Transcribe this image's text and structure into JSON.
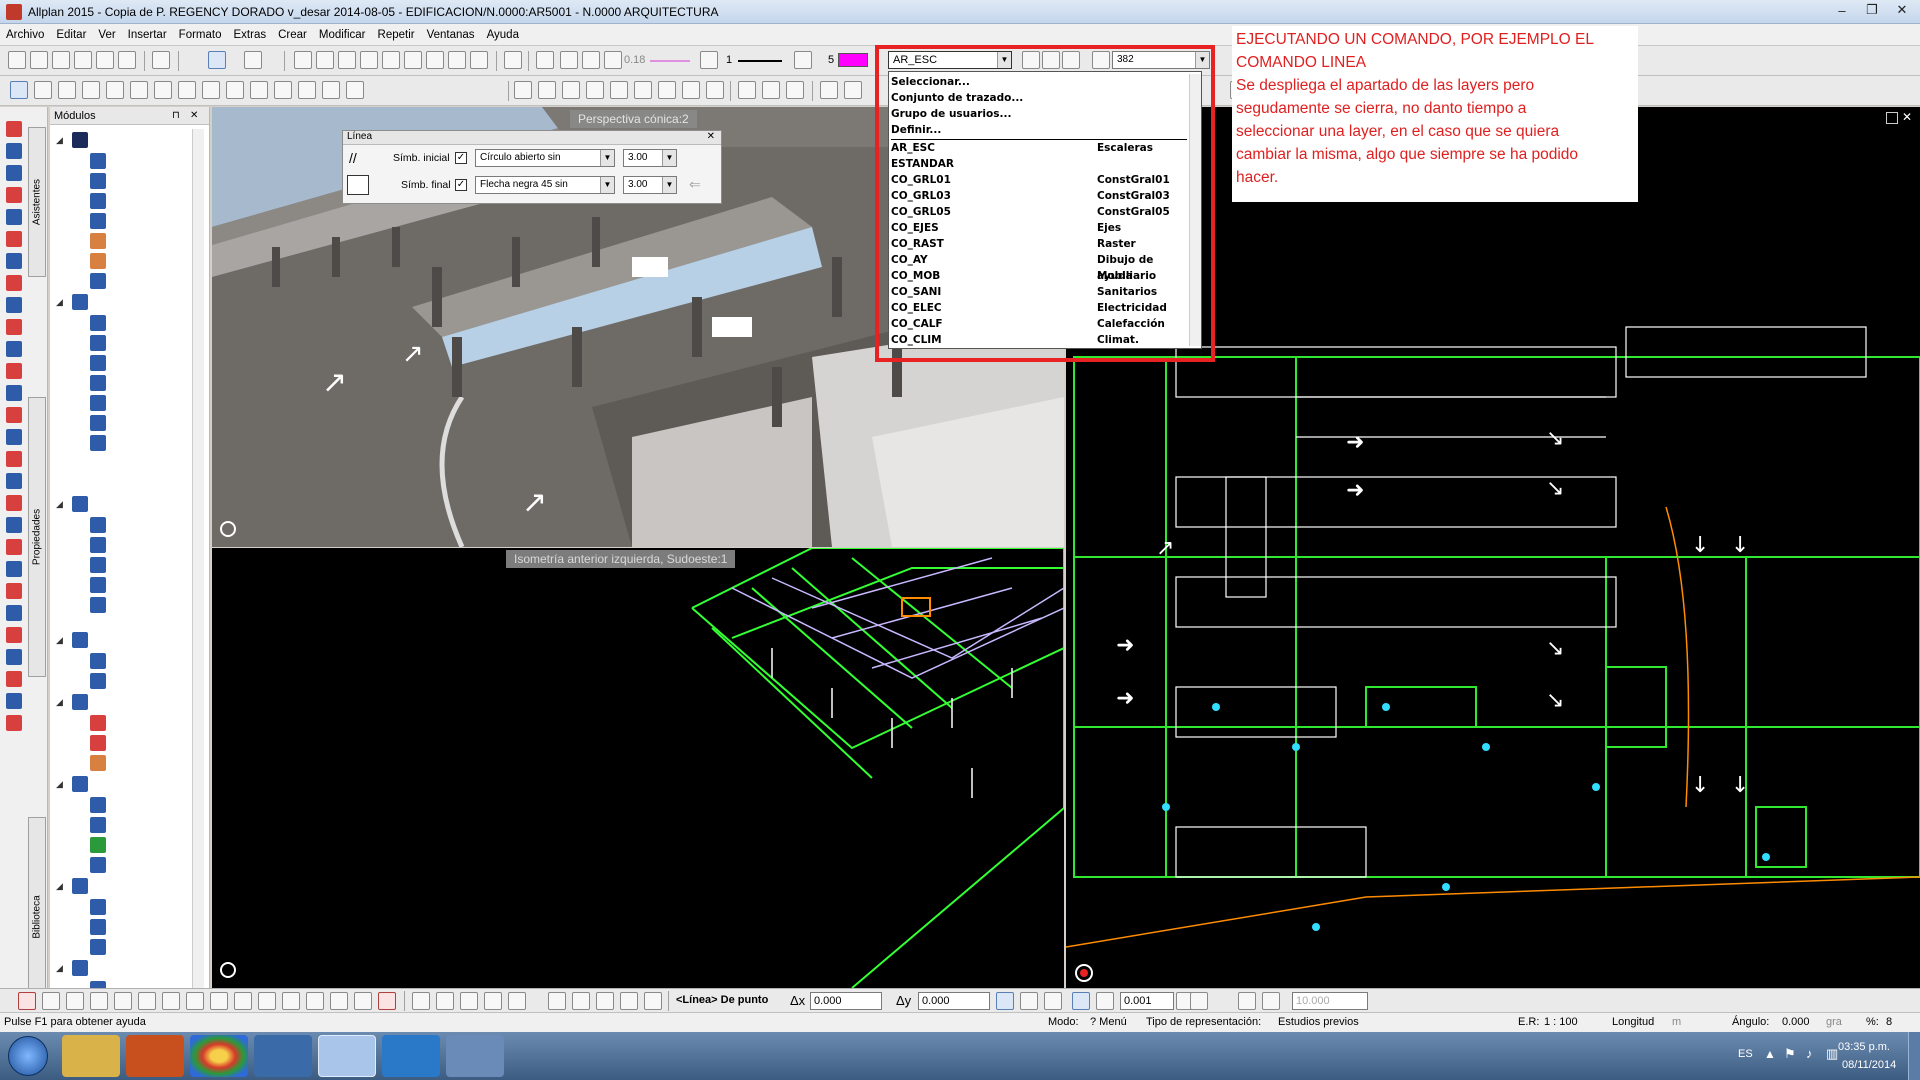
{
  "window": {
    "title": "Allplan 2015 - Copia de  P. REGENCY DORADO v_desar 2014-08-05 - EDIFICACION/N.0000:AR5001 - N.0000 ARQUITECTURA",
    "minimize": "–",
    "maximize": "❐",
    "close": "✕"
  },
  "menu": [
    "Archivo",
    "Editar",
    "Ver",
    "Insertar",
    "Formato",
    "Extras",
    "Crear",
    "Modificar",
    "Repetir",
    "Ventanas",
    "Ayuda"
  ],
  "toolbar": {
    "pen_value": "0.18",
    "line_value": "1",
    "color_value": "5",
    "layer_value": "AR_ESC",
    "scale_value": "382"
  },
  "modules": {
    "header": "Módulos",
    "pin": "⊓",
    "close": "✕"
  },
  "side_tabs": [
    "Asistentes",
    "Propiedades",
    "Biblioteca"
  ],
  "viewports": {
    "perspective_label": "Perspectiva cónica:2",
    "isometric_label": "Isometría anterior izquierda, Sudoeste:1"
  },
  "linea_panel": {
    "title": "Línea",
    "row1_label": "Símb. inicial",
    "row1_symbol": "Círculo abierto sin",
    "row1_size": "3.00",
    "row2_label": "Símb. final",
    "row2_symbol": "Flecha negra 45 sin",
    "row2_size": "3.00"
  },
  "layer_dropdown": {
    "actions": [
      "Seleccionar...",
      "Conjunto de trazado...",
      "Grupo de usuarios...",
      "Definir..."
    ],
    "layers": [
      {
        "name": "AR_ESC",
        "desc": "Escaleras"
      },
      {
        "name": "ESTANDAR",
        "desc": ""
      },
      {
        "name": "CO_GRL01",
        "desc": "ConstGral01"
      },
      {
        "name": "CO_GRL03",
        "desc": "ConstGral03"
      },
      {
        "name": "CO_GRL05",
        "desc": "ConstGral05"
      },
      {
        "name": "CO_EJES",
        "desc": "Ejes"
      },
      {
        "name": "CO_RAST",
        "desc": "Raster"
      },
      {
        "name": "CO_AY",
        "desc": "Dibujo de ayuda"
      },
      {
        "name": "CO_MOB",
        "desc": "Mobiliario"
      },
      {
        "name": "CO_SANI",
        "desc": "Sanitarios"
      },
      {
        "name": "CO_ELEC",
        "desc": "Electricidad"
      },
      {
        "name": "CO_CALF",
        "desc": "Calefacción"
      },
      {
        "name": "CO_CLIM",
        "desc": "Climat."
      }
    ]
  },
  "annotation": {
    "line1": "EJECUTANDO UN COMANDO, POR EJEMPLO EL",
    "line2": "COMANDO LINEA",
    "line3": "Se despliega el apartado de las layers pero",
    "line4": "segudamente se cierra, no danto tiempo a",
    "line5": "seleccionar una layer, en el caso que se quiera",
    "line6": "cambiar la  misma, algo que siempre se ha podido",
    "line7": "hacer.",
    "color": "#e02020"
  },
  "cmdbar": {
    "prompt": "<Línea> De punto",
    "dx_label": "Δx",
    "dx_value": "0.000",
    "dy_label": "Δy",
    "dy_value": "0.000",
    "step_value": "0.001",
    "dist_value": "10.000"
  },
  "statusbar": {
    "help": "Pulse F1 para obtener ayuda",
    "modo_label": "Modo:",
    "modo_value": "? Menú",
    "repr_label": "Tipo de representación:",
    "repr_value": "Estudios previos",
    "er_label": "E.R:",
    "er_value": "1 : 100",
    "longitud_label": "Longitud",
    "longitud_unit": "m",
    "angulo_label": "Ángulo:",
    "angulo_value": "0.000",
    "angulo_unit": "gra",
    "percent_label": "%:",
    "percent_value": "8"
  },
  "taskbar": {
    "lang": "ES",
    "time": "03:35 p.m.",
    "date": "08/11/2014"
  }
}
